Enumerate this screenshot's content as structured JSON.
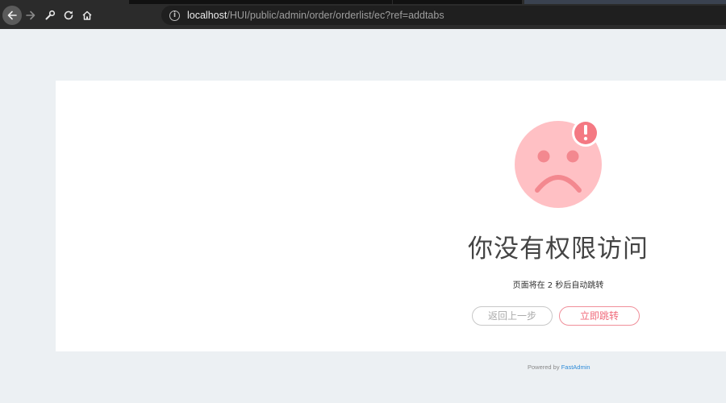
{
  "browser": {
    "url_host": "localhost",
    "url_path": "/HUI/public/admin/order/orderlist/ec?ref=addtabs",
    "icons": [
      "back-arrow-icon",
      "forward-arrow-icon",
      "tools-icon",
      "reload-icon",
      "home-icon",
      "info-icon"
    ]
  },
  "page": {
    "title": "你没有权限访问",
    "subtitle": "页面将在 2 秒后自动跳转",
    "back_button": "返回上一步",
    "redirect_button": "立即跳转",
    "face_icon": "sad-face-icon",
    "badge_icon": "exclamation-icon"
  },
  "footer": {
    "powered_by": "Powered by",
    "brand": "FastAdmin"
  },
  "colors": {
    "background": "#ecf0f3",
    "card": "#ffffff",
    "face": "#ffc0c4",
    "face_features": "#f3888f",
    "badge": "#f47983",
    "accent": "#f06a7a",
    "link": "#2c8ad8"
  }
}
